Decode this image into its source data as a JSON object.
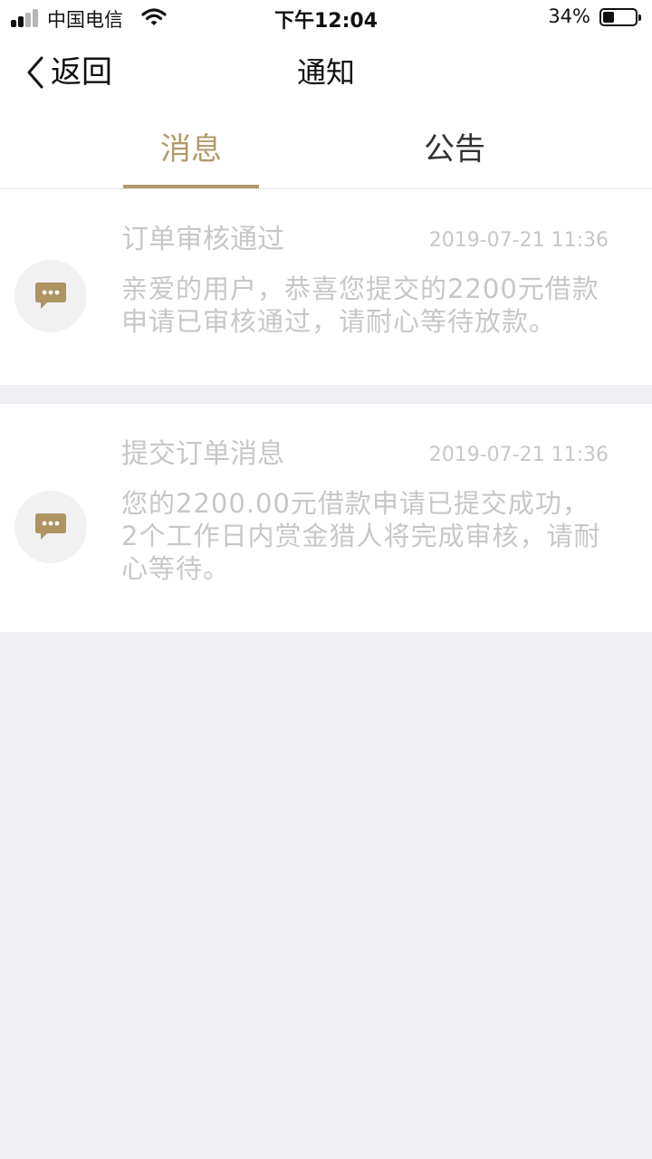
{
  "status_bar": {
    "carrier": "中国电信",
    "time": "下午12:04",
    "battery_percent": "34%",
    "battery_level": 0.34
  },
  "nav": {
    "back_label": "返回",
    "title": "通知"
  },
  "tabs": [
    {
      "label": "消息",
      "active": true
    },
    {
      "label": "公告",
      "active": false
    }
  ],
  "messages": [
    {
      "title": "订单审核通过",
      "time": "2019-07-21 11:36",
      "body": "亲爱的用户，恭喜您提交的2200元借款申请已审核通过，请耐心等待放款。",
      "icon": "chat-bubble-icon"
    },
    {
      "title": "提交订单消息",
      "time": "2019-07-21 11:36",
      "body": "您的2200.00元借款申请已提交成功，2个工作日内赏金猎人将完成审核，请耐心等待。",
      "icon": "chat-bubble-icon"
    }
  ],
  "colors": {
    "accent": "#b19a6d",
    "background": "#efeff4",
    "muted_text": "#c7c7c7",
    "icon_fill": "#ad9461"
  }
}
